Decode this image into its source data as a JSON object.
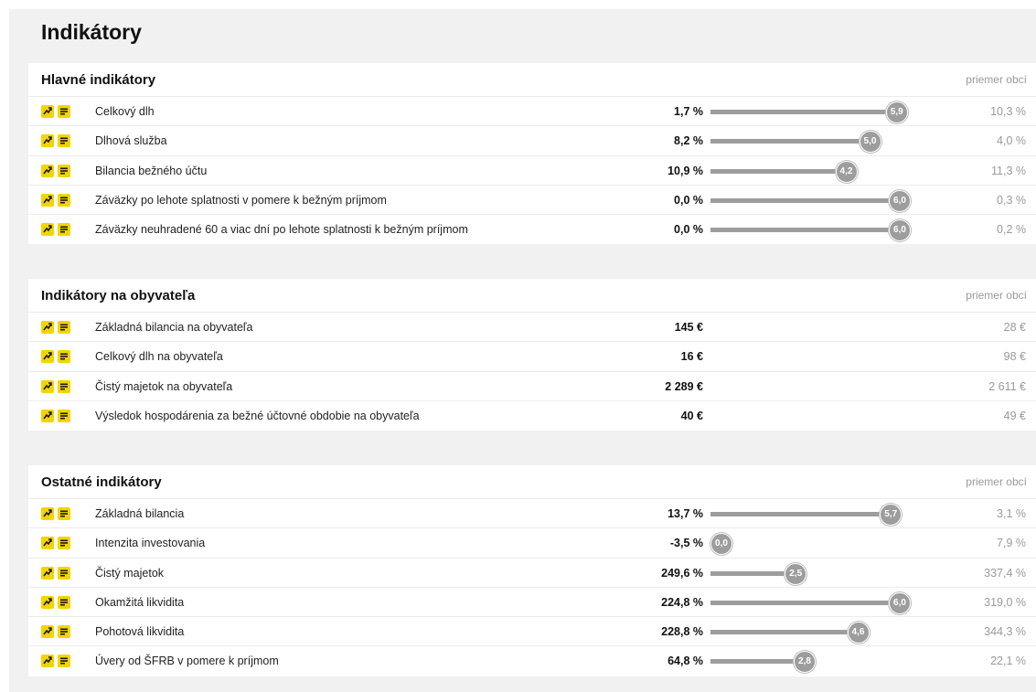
{
  "page_title": "Indikátory",
  "sections": [
    {
      "title": "Hlavné indikátory",
      "note": "priemer obcí",
      "rows": [
        {
          "label": "Celkový dlh",
          "value": "1,7 %",
          "score": 5.9,
          "score_label": "5,9",
          "avg": "10,3 %"
        },
        {
          "label": "Dlhová služba",
          "value": "8,2 %",
          "score": 5.0,
          "score_label": "5,0",
          "avg": "4,0 %"
        },
        {
          "label": "Bilancia bežného účtu",
          "value": "10,9 %",
          "score": 4.2,
          "score_label": "4,2",
          "avg": "11,3 %"
        },
        {
          "label": "Záväzky po lehote splatnosti v pomere k bežným príjmom",
          "value": "0,0 %",
          "score": 6.0,
          "score_label": "6,0",
          "avg": "0,3 %"
        },
        {
          "label": "Záväzky neuhradené 60 a viac dní po lehote splatnosti k bežným príjmom",
          "value": "0,0 %",
          "score": 6.0,
          "score_label": "6,0",
          "avg": "0,2 %"
        }
      ]
    },
    {
      "title": "Indikátory na obyvateľa",
      "note": "priemer obcí",
      "rows": [
        {
          "label": "Základná bilancia na obyvateľa",
          "value": "145 €",
          "avg": "28 €"
        },
        {
          "label": "Celkový dlh na obyvateľa",
          "value": "16 €",
          "avg": "98 €"
        },
        {
          "label": "Čistý majetok na obyvateľa",
          "value": "2 289 €",
          "avg": "2 611 €"
        },
        {
          "label": "Výsledok hospodárenia za bežné účtovné obdobie na obyvateľa",
          "value": "40 €",
          "avg": "49 €"
        }
      ]
    },
    {
      "title": "Ostatné indikátory",
      "note": "priemer obcí",
      "rows": [
        {
          "label": "Základná bilancia",
          "value": "13,7 %",
          "score": 5.7,
          "score_label": "5,7",
          "avg": "3,1 %"
        },
        {
          "label": "Intenzita investovania",
          "value": "-3,5 %",
          "score": 0.0,
          "score_label": "0,0",
          "avg": "7,9 %"
        },
        {
          "label": "Čistý majetok",
          "value": "249,6 %",
          "score": 2.5,
          "score_label": "2,5",
          "avg": "337,4 %"
        },
        {
          "label": "Okamžitá likvidita",
          "value": "224,8 %",
          "score": 6.0,
          "score_label": "6,0",
          "avg": "319,0 %"
        },
        {
          "label": "Pohotová likvidita",
          "value": "228,8 %",
          "score": 4.6,
          "score_label": "4,6",
          "avg": "344,3 %"
        },
        {
          "label": "Úvery od ŠFRB v pomere k príjmom",
          "value": "64,8 %",
          "score": 2.8,
          "score_label": "2,8",
          "avg": "22,1 %"
        }
      ]
    }
  ],
  "score_max": 6.0,
  "colors": {
    "icon_bg": "#f2d500",
    "bar": "#9d9d9d",
    "muted": "#9a9a9a"
  },
  "icons": [
    "trend-chart-icon",
    "document-lines-icon"
  ]
}
